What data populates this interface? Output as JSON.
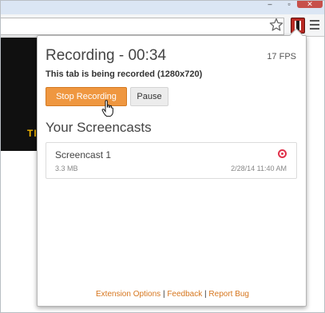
{
  "window": {
    "minimize_glyph": "–",
    "maximize_glyph": "▫",
    "close_glyph": "✕"
  },
  "page": {
    "banner_text": "TIP"
  },
  "popup": {
    "recording_title": "Recording - 00:34",
    "fps": "17 FPS",
    "subtitle": "This tab is being recorded (1280x720)",
    "stop_label": "Stop Recording",
    "pause_label": "Pause",
    "section_title": "Your Screencasts",
    "screencasts": [
      {
        "name": "Screencast 1",
        "size": "3.3 MB",
        "date": "2/28/14 11:40 AM"
      }
    ],
    "footer": {
      "options": "Extension Options",
      "sep1": " | ",
      "feedback": "Feedback",
      "sep2": " | ",
      "report": "Report Bug"
    }
  },
  "colors": {
    "accent": "#ef9740",
    "record_red": "#e0324b",
    "footer_link": "#d6761e"
  },
  "icons": [
    "star-icon",
    "screencast-extension-icon",
    "menu-icon",
    "record-icon",
    "hand-cursor-icon"
  ]
}
